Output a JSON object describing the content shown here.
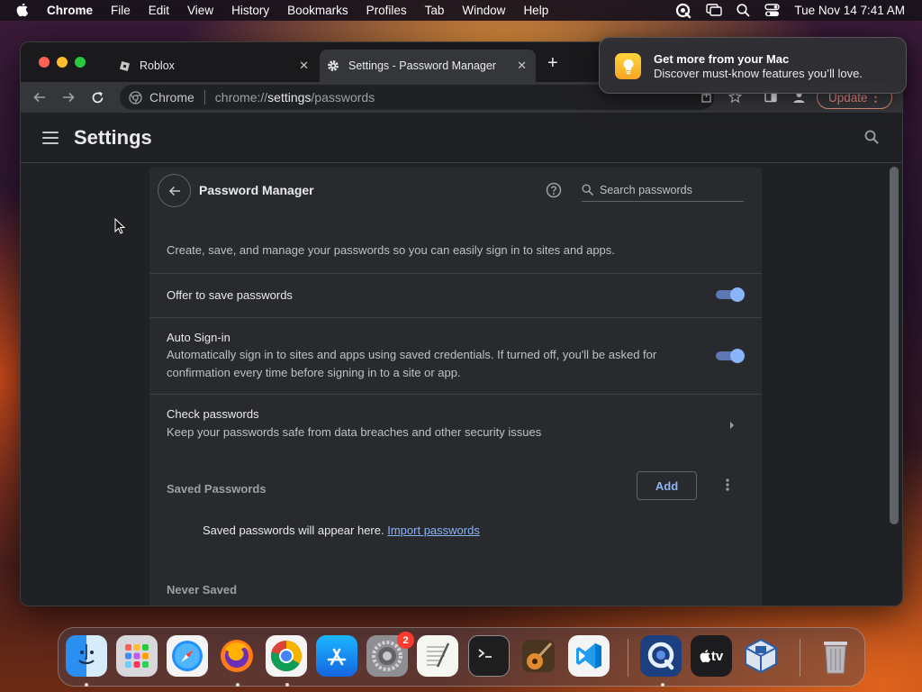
{
  "menubar": {
    "app_name": "Chrome",
    "menus": [
      "File",
      "Edit",
      "View",
      "History",
      "Bookmarks",
      "Profiles",
      "Tab",
      "Window",
      "Help"
    ],
    "clock": "Tue Nov 14  7:41 AM"
  },
  "tabs": [
    {
      "title": "Roblox",
      "icon": "roblox-icon"
    },
    {
      "title": "Settings - Password Manager",
      "icon": "gear-icon",
      "active": true
    }
  ],
  "omnibox": {
    "chip_label": "Chrome",
    "url_scheme": "chrome://",
    "url_host": "settings",
    "url_path": "/passwords"
  },
  "toolbar": {
    "update_label": "Update"
  },
  "settings": {
    "title": "Settings"
  },
  "password_manager": {
    "title": "Password Manager",
    "search_placeholder": "Search passwords",
    "intro": "Create, save, and manage your passwords so you can easily sign in to sites and apps.",
    "offer_to_save": {
      "label": "Offer to save passwords",
      "enabled": true
    },
    "auto_signin": {
      "label": "Auto Sign-in",
      "description": "Automatically sign in to sites and apps using saved credentials. If turned off, you'll be asked for confirmation every time before signing in to a site or app.",
      "enabled": true
    },
    "check_passwords": {
      "label": "Check passwords",
      "description": "Keep your passwords safe from data breaches and other security issues"
    },
    "saved_passwords": {
      "label": "Saved Passwords",
      "add_label": "Add",
      "empty_text": "Saved passwords will appear here.",
      "import_link": "Import passwords"
    },
    "never_saved": {
      "label": "Never Saved"
    }
  },
  "notification": {
    "title": "Get more from your Mac",
    "body": "Discover must-know features you’ll love."
  },
  "dock": {
    "apps": [
      "Finder",
      "Launchpad",
      "Safari",
      "Firefox",
      "Chrome",
      "App Store",
      "System Settings",
      "TextEdit",
      "Terminal",
      "GarageBand",
      "Visual Studio Code",
      "QuickTime",
      "Apple TV",
      "VirtualBox",
      "Trash"
    ],
    "system_settings_badge": "2",
    "apple_tv_label": "tv"
  },
  "colors": {
    "accent": "#8ab4f8",
    "toggle_track": "#5d77b5",
    "page_bg": "#202124",
    "card_bg": "#292a2d"
  }
}
